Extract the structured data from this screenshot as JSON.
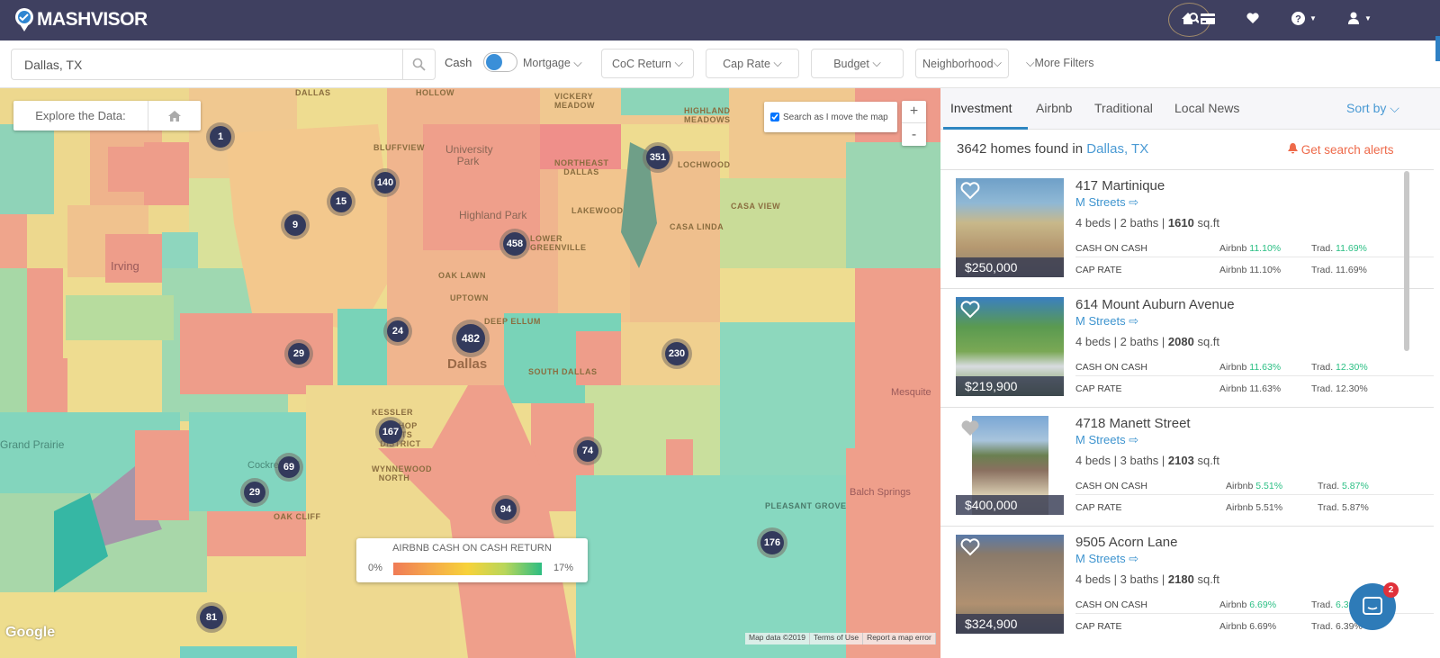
{
  "brand": {
    "name": "MASHVISOR"
  },
  "nav": {
    "icons": [
      "property-search-icon",
      "credit-card-icon",
      "heart-icon",
      "help-icon",
      "user-icon"
    ]
  },
  "filters": {
    "search_value": "Dallas, TX",
    "search_placeholder": "Dallas, TX",
    "cash_label": "Cash",
    "mortgage_label": "Mortgage",
    "coc_label": "CoC Return",
    "cap_label": "Cap Rate",
    "budget_label": "Budget",
    "neighborhood_label": "Neighborhood",
    "more_label": "More Filters"
  },
  "map": {
    "explore_label": "Explore the Data:",
    "search_move_label": "Search as I move the map",
    "search_move_checked": true,
    "zoom_in": "+",
    "zoom_out": "-",
    "clusters": [
      "1",
      "140",
      "15",
      "9",
      "351",
      "458",
      "482",
      "24",
      "29",
      "230",
      "167",
      "69",
      "29",
      "74",
      "94",
      "176",
      "81"
    ],
    "places": [
      "DALLAS",
      "HOLLOW",
      "VICKERY MEADOW",
      "HIGHLAND MEADOWS",
      "BLUFFVIEW",
      "University Park",
      "NORTHEAST DALLAS",
      "LOCHWOOD",
      "Highland Park",
      "LAKEWOOD",
      "CASA LINDA",
      "CASA VIEW",
      "LOWER GREENVILLE",
      "OAK LAWN",
      "UPTOWN",
      "DEEP ELLUM",
      "Dallas",
      "SOUTH DALLAS",
      "Irving",
      "KESSLER",
      "BISHOP ARTS DISTRICT",
      "WYNNEWOOD NORTH",
      "Grand Prairie",
      "Cockrell Hill",
      "OAK CLIFF",
      "PLEASANT GROVE",
      "Balch Springs",
      "Mesquite"
    ],
    "legend": {
      "title": "AIRBNB CASH ON CASH RETURN",
      "min": "0%",
      "max": "17%"
    },
    "google": "Google",
    "footer": [
      "Map data ©2019",
      "Terms of Use",
      "Report a map error"
    ]
  },
  "panel": {
    "tabs": [
      {
        "label": "Investment",
        "active": true
      },
      {
        "label": "Airbnb",
        "active": false
      },
      {
        "label": "Traditional",
        "active": false
      },
      {
        "label": "Local News",
        "active": false
      }
    ],
    "sort_label": "Sort by",
    "found_prefix": "3642 homes found in",
    "found_city": "Dallas, TX",
    "alerts_label": "Get search alerts",
    "coc_row_label": "CASH ON CASH",
    "cap_row_label": "CAP RATE",
    "airbnb_prefix": "Airbnb",
    "trad_prefix": "Trad.",
    "listings": [
      {
        "address": "417 Martinique",
        "neighborhood": "M Streets",
        "beds": "4 beds",
        "baths": "2 baths",
        "sqft": "1610",
        "sqft_unit": "sq.ft",
        "price": "$250,000",
        "coc_airbnb": "11.10%",
        "coc_trad": "11.69%",
        "cap_airbnb": "11.10%",
        "cap_trad": "11.69%"
      },
      {
        "address": "614 Mount Auburn Avenue",
        "neighborhood": "M Streets",
        "beds": "4 beds",
        "baths": "2 baths",
        "sqft": "2080",
        "sqft_unit": "sq.ft",
        "price": "$219,900",
        "coc_airbnb": "11.63%",
        "coc_trad": "12.30%",
        "cap_airbnb": "11.63%",
        "cap_trad": "12.30%"
      },
      {
        "address": "4718 Manett Street",
        "neighborhood": "M Streets",
        "beds": "4 beds",
        "baths": "3 baths",
        "sqft": "2103",
        "sqft_unit": "sq.ft",
        "price": "$400,000",
        "coc_airbnb": "5.51%",
        "coc_trad": "5.87%",
        "cap_airbnb": "5.51%",
        "cap_trad": "5.87%"
      },
      {
        "address": "9505 Acorn Lane",
        "neighborhood": "M Streets",
        "beds": "4 beds",
        "baths": "3 baths",
        "sqft": "2180",
        "sqft_unit": "sq.ft",
        "price": "$324,900",
        "coc_airbnb": "6.69%",
        "coc_trad": "6.39%",
        "cap_airbnb": "6.69%",
        "cap_trad": "6.39%"
      }
    ]
  },
  "chat": {
    "badge": "2"
  },
  "colors": {
    "nav_bg": "#3f4060",
    "accent_blue": "#4a9ad4",
    "alert_orange": "#ee6a4a",
    "positive_green": "#2bbf84",
    "cluster_bg": "#333a5c"
  }
}
